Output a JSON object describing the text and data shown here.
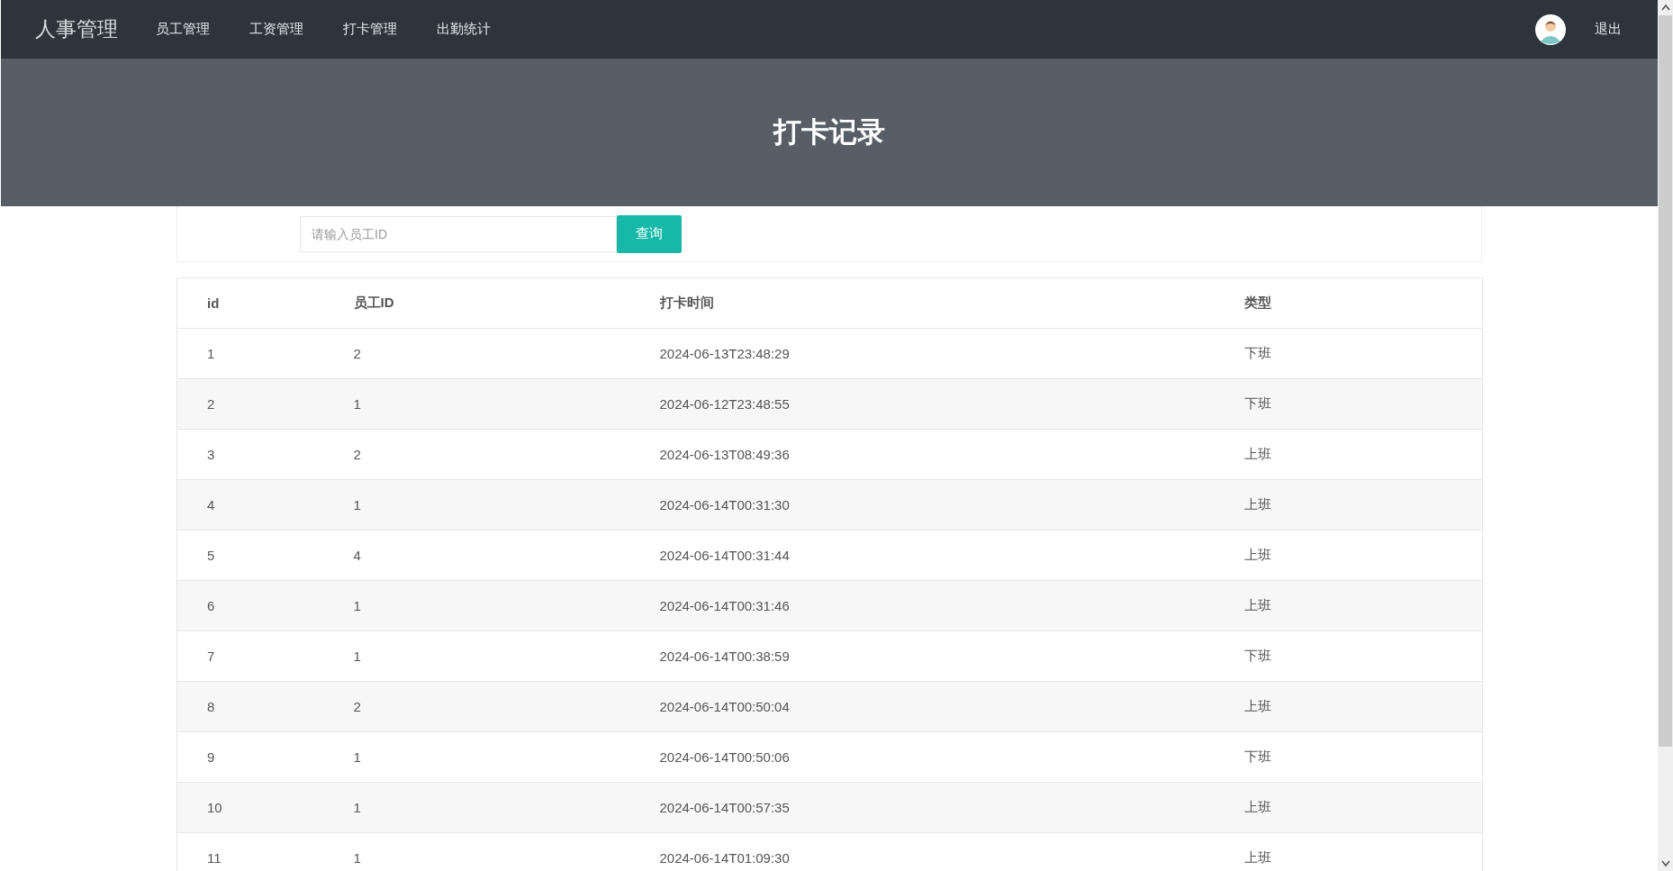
{
  "navbar": {
    "brand": "人事管理",
    "items": [
      {
        "label": "员工管理"
      },
      {
        "label": "工资管理"
      },
      {
        "label": "打卡管理"
      },
      {
        "label": "出勤统计"
      }
    ],
    "logout": "退出"
  },
  "banner": {
    "title": "打卡记录"
  },
  "search": {
    "placeholder": "请输入员工ID",
    "button": "查询"
  },
  "table": {
    "columns": [
      "id",
      "员工ID",
      "打卡时间",
      "类型"
    ],
    "rows": [
      [
        "1",
        "2",
        "2024-06-13T23:48:29",
        "下班"
      ],
      [
        "2",
        "1",
        "2024-06-12T23:48:55",
        "下班"
      ],
      [
        "3",
        "2",
        "2024-06-13T08:49:36",
        "上班"
      ],
      [
        "4",
        "1",
        "2024-06-14T00:31:30",
        "上班"
      ],
      [
        "5",
        "4",
        "2024-06-14T00:31:44",
        "上班"
      ],
      [
        "6",
        "1",
        "2024-06-14T00:31:46",
        "上班"
      ],
      [
        "7",
        "1",
        "2024-06-14T00:38:59",
        "下班"
      ],
      [
        "8",
        "2",
        "2024-06-14T00:50:04",
        "上班"
      ],
      [
        "9",
        "1",
        "2024-06-14T00:50:06",
        "下班"
      ],
      [
        "10",
        "1",
        "2024-06-14T00:57:35",
        "上班"
      ],
      [
        "11",
        "1",
        "2024-06-14T01:09:30",
        "上班"
      ]
    ]
  }
}
